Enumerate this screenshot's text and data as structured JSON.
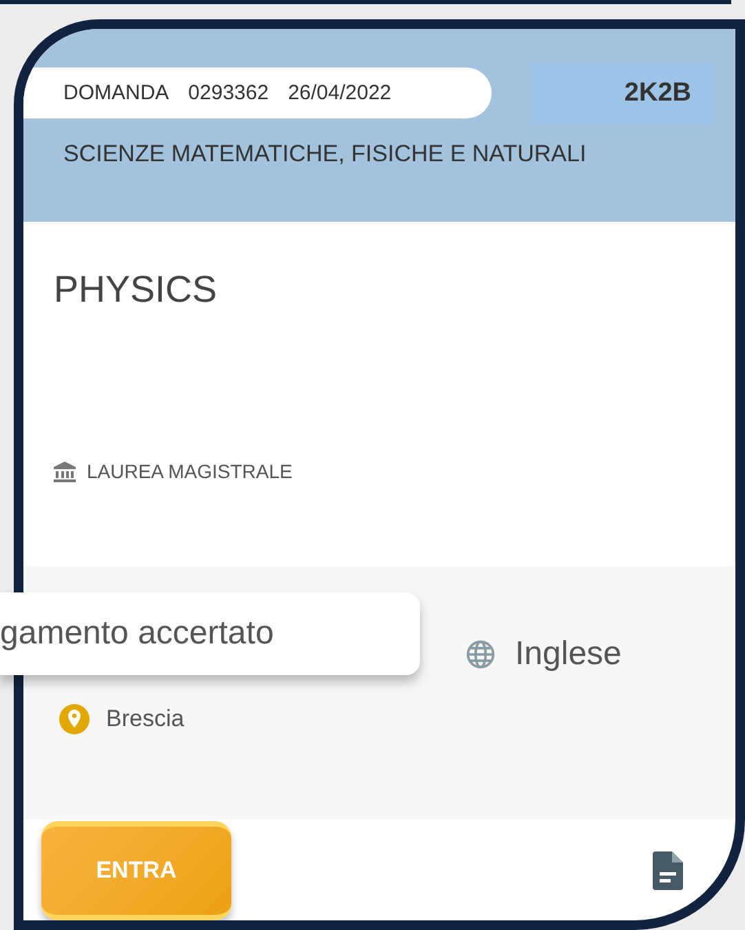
{
  "application": {
    "label": "DOMANDA",
    "number": "0293362",
    "date": "26/04/2022",
    "code": "2K2B"
  },
  "faculty": "SCIENZE MATEMATICHE, FISICHE E NATURALI",
  "course": {
    "title": "PHYSICS",
    "degree_type": "LAUREA MAGISTRALE"
  },
  "tooltip": "gamento accertato",
  "language": "Inglese",
  "city": "Brescia",
  "button": "ENTRA"
}
